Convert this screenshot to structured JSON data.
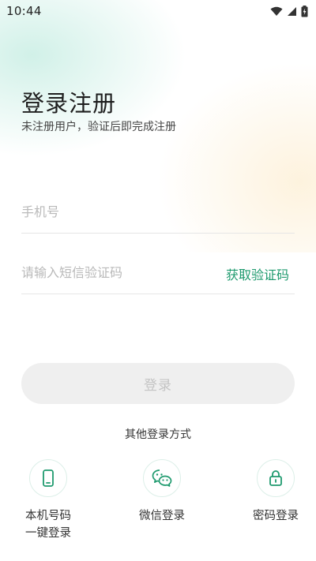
{
  "status_bar": {
    "time": "10:44"
  },
  "header": {
    "title": "登录注册",
    "subtitle": "未注册用户，验证后即完成注册"
  },
  "form": {
    "phone_placeholder": "手机号",
    "code_placeholder": "请输入短信验证码",
    "get_code_label": "获取验证码",
    "login_label": "登录"
  },
  "other_login": {
    "title": "其他登录方式",
    "methods": [
      {
        "label_line1": "本机号码",
        "label_line2": "一键登录",
        "icon": "phone-icon"
      },
      {
        "label": "微信登录",
        "icon": "wechat-icon"
      },
      {
        "label": "密码登录",
        "icon": "lock-icon"
      }
    ]
  },
  "colors": {
    "accent": "#1e9a6e",
    "button_bg": "#efefef",
    "button_text": "#c4c4c4"
  }
}
